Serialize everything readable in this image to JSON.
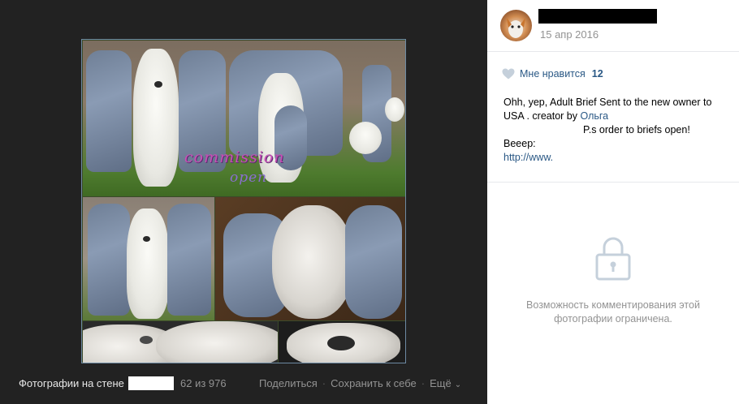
{
  "photo": {
    "overlay_line1": "commission",
    "overlay_line2": "open"
  },
  "footer": {
    "album_label": "Фотографии на стене",
    "counter": "62 из 976",
    "share": "Поделиться",
    "save": "Сохранить к себе",
    "more": "Ещё"
  },
  "post": {
    "date": "15 апр 2016",
    "likes_label": "Мне нравится",
    "likes_count": "12",
    "text_line1": "Ohh, yep, Adult Brief Sent to the new owner to",
    "text_line2a": "USA . creator by ",
    "creator_link": "Ольга",
    "text_line3": "P.s order to briefs open!",
    "text_line4": "Beeep:",
    "url": "http://www."
  },
  "comments": {
    "restricted_text": "Возможность комментирования этой фотографии ограничена."
  },
  "colors": {
    "viewer_bg": "#222222",
    "link": "#2a5885",
    "muted": "#939393",
    "overlay_text": "#c84fb6"
  }
}
